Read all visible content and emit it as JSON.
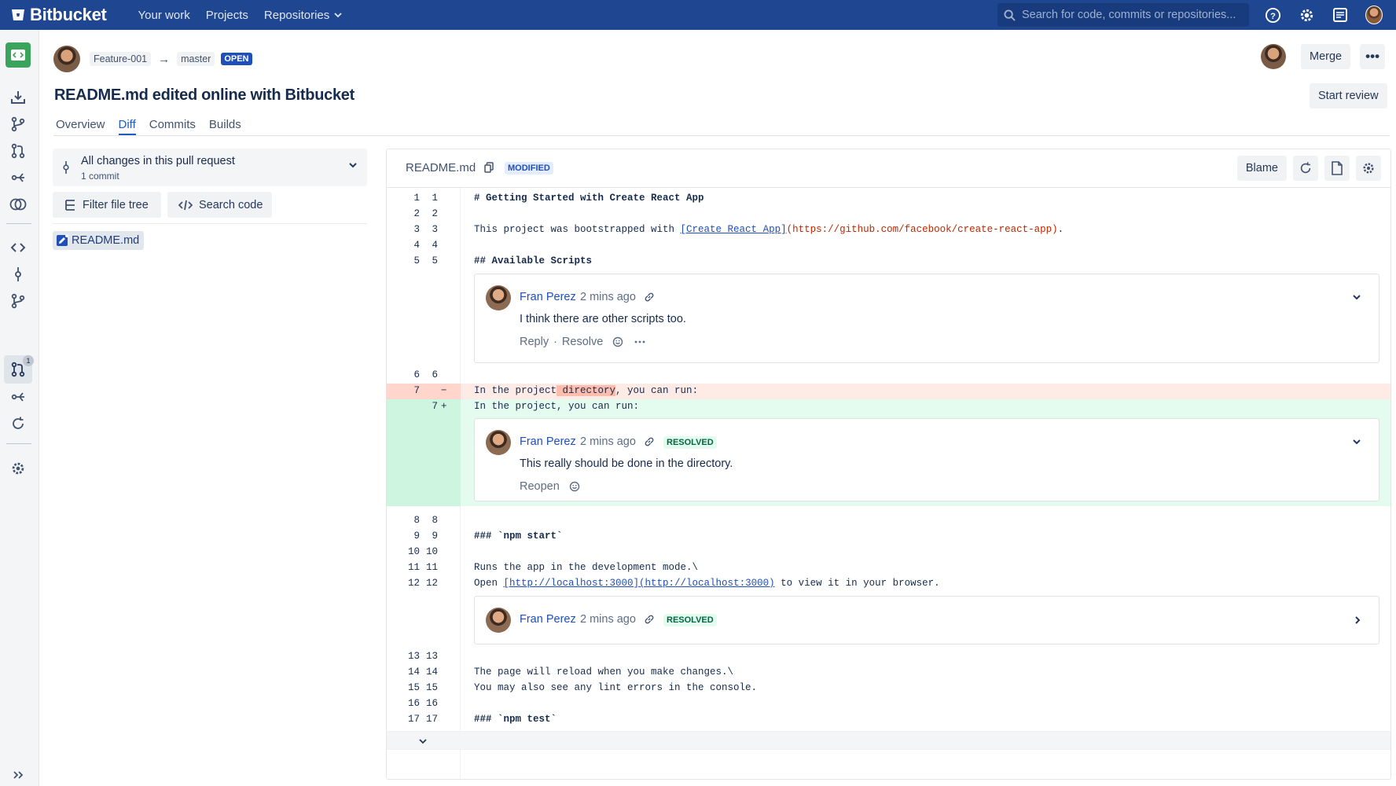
{
  "topbar": {
    "brand": "Bitbucket",
    "nav": [
      "Your work",
      "Projects",
      "Repositories"
    ],
    "search_placeholder": "Search for code, commits or repositories...",
    "brand_color": "#1f4690"
  },
  "sidebar": {
    "pr_badge": "1"
  },
  "pr": {
    "source_branch": "Feature-001",
    "arrow": "→",
    "target_branch": "master",
    "status": "OPEN",
    "title": "README.md edited online with Bitbucket",
    "merge_label": "Merge",
    "more_label": "•••",
    "start_review_label": "Start review",
    "tabs": [
      "Overview",
      "Diff",
      "Commits",
      "Builds"
    ],
    "active_tab": "Diff"
  },
  "filetree": {
    "changes_title": "All changes in this pull request",
    "changes_sub": "1 commit",
    "filter_label": "Filter file tree",
    "search_label": "Search code",
    "files": [
      "README.md"
    ]
  },
  "diff": {
    "filename": "README.md",
    "status": "MODIFIED",
    "blame_label": "Blame",
    "lines": {
      "l1": {
        "n1": "1",
        "n2": "1",
        "text": "# Getting Started with Create React App"
      },
      "l2": {
        "n1": "2",
        "n2": "2",
        "text": ""
      },
      "l3": {
        "n1": "3",
        "n2": "3",
        "pre": "This project was bootstrapped with ",
        "link": "[Create React App]",
        "url": "(https://github.com/facebook/create-react-app)",
        "post": "."
      },
      "l4": {
        "n1": "4",
        "n2": "4",
        "text": ""
      },
      "l5": {
        "n1": "5",
        "n2": "5",
        "text": "## Available Scripts"
      },
      "l6": {
        "n1": "6",
        "n2": "6",
        "text": ""
      },
      "l7del": {
        "n1": "7",
        "mk": "−",
        "pre": "In the project",
        "hl": " directory",
        "post": ", you can run:"
      },
      "l7add": {
        "n2": "7",
        "mk": "+",
        "text": "In the project, you can run:"
      },
      "l8": {
        "n1": "8",
        "n2": "8",
        "text": ""
      },
      "l9": {
        "n1": "9",
        "n2": "9",
        "text": "### `npm start`"
      },
      "l10": {
        "n1": "10",
        "n2": "10",
        "text": ""
      },
      "l11": {
        "n1": "11",
        "n2": "11",
        "text": "Runs the app in the development mode.\\"
      },
      "l12": {
        "n1": "12",
        "n2": "12",
        "pre": "Open ",
        "link": "[http://localhost:3000](http://localhost:3000)",
        "post": " to view it in your browser."
      },
      "l13": {
        "n1": "13",
        "n2": "13",
        "text": ""
      },
      "l14": {
        "n1": "14",
        "n2": "14",
        "text": "The page will reload when you make changes.\\"
      },
      "l15": {
        "n1": "15",
        "n2": "15",
        "text": "You may also see any lint errors in the console."
      },
      "l16": {
        "n1": "16",
        "n2": "16",
        "text": ""
      },
      "l17": {
        "n1": "17",
        "n2": "17",
        "text": "### `npm test`"
      }
    }
  },
  "comments": {
    "c1": {
      "author": "Fran Perez",
      "time": "2 mins ago",
      "text": "I think there are other scripts too.",
      "reply": "Reply",
      "dot": "·",
      "resolve": "Resolve"
    },
    "c2": {
      "author": "Fran Perez",
      "time": "2 mins ago",
      "status": "RESOLVED",
      "text": "This really should be done in the directory.",
      "reopen": "Reopen"
    },
    "c3": {
      "author": "Fran Perez",
      "time": "2 mins ago",
      "status": "RESOLVED"
    }
  }
}
